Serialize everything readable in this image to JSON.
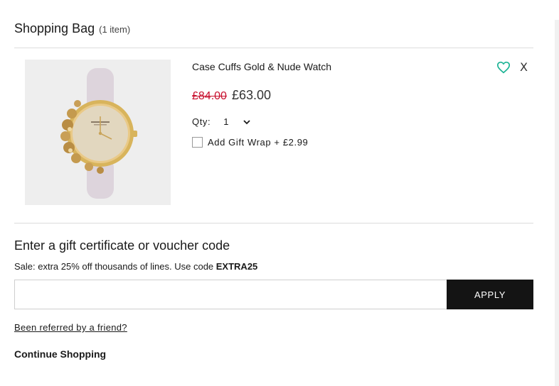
{
  "bag": {
    "title": "Shopping Bag",
    "count": "(1 item)"
  },
  "item": {
    "name": "Case Cuffs Gold & Nude Watch",
    "image_alt": "Case Cuffs Gold & Nude Watch image",
    "old_price": "£84.00",
    "price": "£63.00",
    "qty_label": "Qty:",
    "qty_value": "1",
    "gift_wrap_label": "Add Gift Wrap + £2.99",
    "gift_wrap_checked": false,
    "remove_label": "X",
    "wishlist_icon": "heart-outline-icon",
    "wishlist_color": "#1ab394"
  },
  "voucher": {
    "title": "Enter a gift certificate or voucher code",
    "promo_text": "Sale: extra 25% off thousands of lines. Use code ",
    "promo_code": "EXTRA25",
    "input_value": "",
    "input_placeholder": "",
    "apply_label": "APPLY"
  },
  "links": {
    "referred": "Been referred by a friend?",
    "continue": "Continue Shopping"
  },
  "colors": {
    "sale_price": "#c8102e",
    "apply_button": "#141414",
    "accent": "#1ab394"
  }
}
